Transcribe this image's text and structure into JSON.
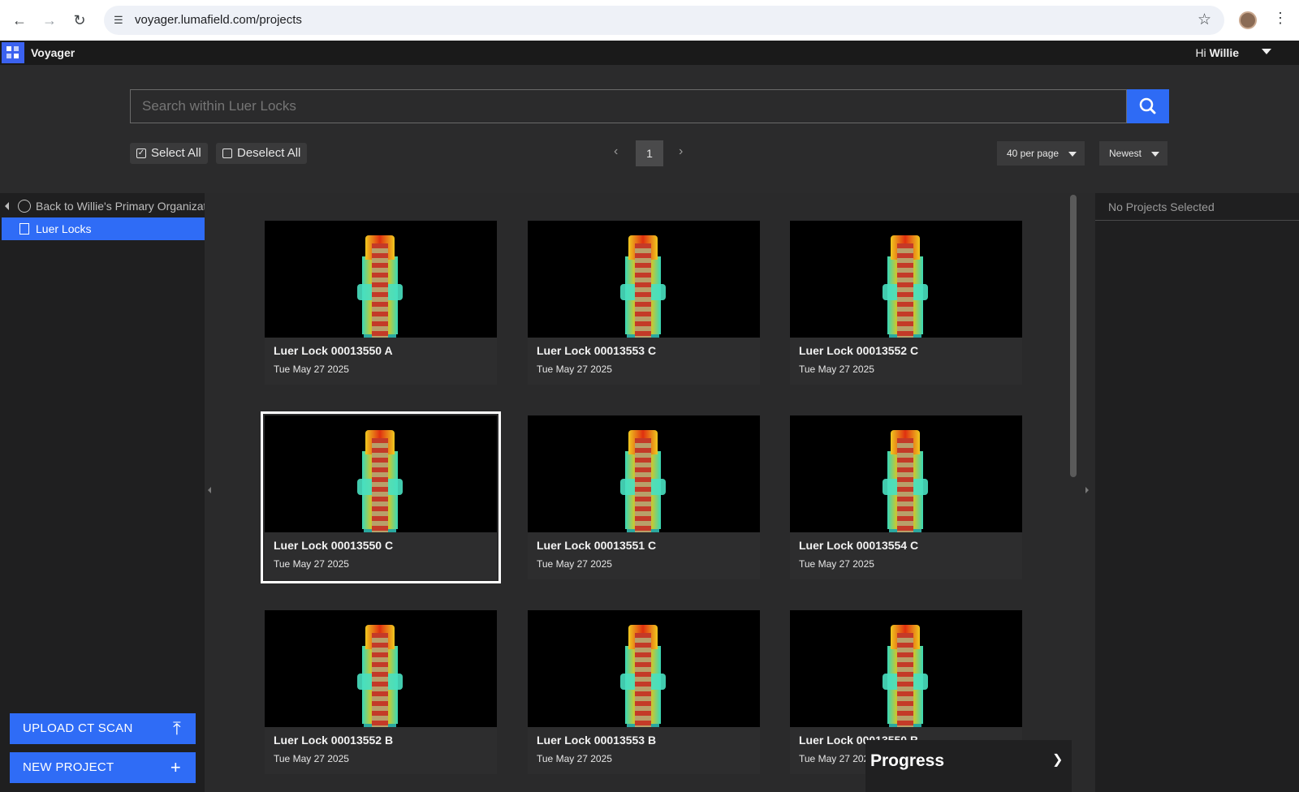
{
  "browser": {
    "url": "voyager.lumafield.com/projects",
    "back_icon": "arrow-left-icon",
    "forward_icon": "arrow-right-icon",
    "reload_icon": "reload-icon"
  },
  "app": {
    "title": "Voyager",
    "greeting_prefix": "Hi",
    "user": "Willie",
    "brand_color": "#2f6cf6"
  },
  "toolbar": {
    "search_placeholder": "Search within Luer Locks",
    "select_all": "Select All",
    "deselect_all": "Deselect All",
    "page": "1",
    "per_page": "40 per page",
    "sort": "Newest"
  },
  "sidebar": {
    "back_label": "Back to Willie's Primary Organizat",
    "active_item": "Luer Locks",
    "upload_label": "UPLOAD CT SCAN",
    "new_project_label": "NEW PROJECT"
  },
  "right_panel": {
    "header": "No Projects Selected"
  },
  "projects": [
    {
      "name": "Luer Lock 00013550 A",
      "date": "Tue May 27 2025"
    },
    {
      "name": "Luer Lock 00013553 C",
      "date": "Tue May 27 2025"
    },
    {
      "name": "Luer Lock 00013552 C",
      "date": "Tue May 27 2025"
    },
    {
      "name": "Luer Lock 00013550 C",
      "date": "Tue May 27 2025"
    },
    {
      "name": "Luer Lock 00013551 C",
      "date": "Tue May 27 2025"
    },
    {
      "name": "Luer Lock 00013554 C",
      "date": "Tue May 27 2025"
    },
    {
      "name": "Luer Lock 00013552 B",
      "date": "Tue May 27 2025"
    },
    {
      "name": "Luer Lock 00013553 B",
      "date": "Tue May 27 2025"
    },
    {
      "name": "Luer Lock 00013550 B",
      "date": "Tue May 27 2025"
    }
  ],
  "progress": {
    "title": "Progress"
  }
}
